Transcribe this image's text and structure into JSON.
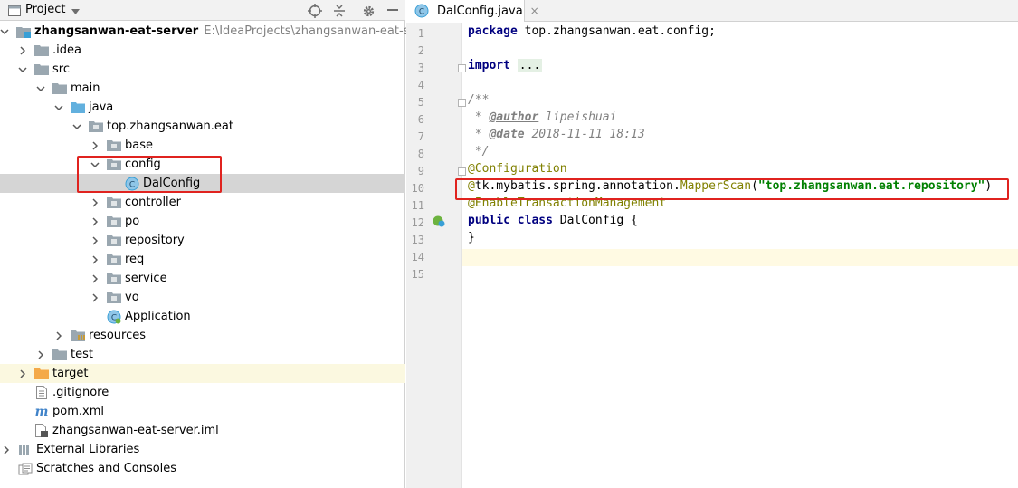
{
  "project_panel": {
    "title": "Project",
    "header_icons": [
      "locate-icon",
      "collapse-icon",
      "settings-icon",
      "hide-icon"
    ]
  },
  "tree": [
    {
      "id": "root",
      "label": "zhangsanwan-eat-server",
      "path": "E:\\IdeaProjects\\zhangsanwan-eat-server",
      "icon": "module-folder-icon",
      "expanded": true
    },
    {
      "id": "idea",
      "label": ".idea",
      "icon": "folder-icon",
      "expanded": false
    },
    {
      "id": "src",
      "label": "src",
      "icon": "folder-icon",
      "expanded": true
    },
    {
      "id": "main",
      "label": "main",
      "icon": "folder-icon",
      "expanded": true
    },
    {
      "id": "java",
      "label": "java",
      "icon": "source-folder-icon",
      "expanded": true
    },
    {
      "id": "pkg",
      "label": "top.zhangsanwan.eat",
      "icon": "package-icon",
      "expanded": true
    },
    {
      "id": "base",
      "label": "base",
      "icon": "package-icon",
      "expanded": false
    },
    {
      "id": "config",
      "label": "config",
      "icon": "package-icon",
      "expanded": true
    },
    {
      "id": "dalconfig",
      "label": "DalConfig",
      "icon": "class-icon",
      "selected": true
    },
    {
      "id": "controller",
      "label": "controller",
      "icon": "package-icon",
      "expanded": false
    },
    {
      "id": "po",
      "label": "po",
      "icon": "package-icon",
      "expanded": false
    },
    {
      "id": "repository",
      "label": "repository",
      "icon": "package-icon",
      "expanded": false
    },
    {
      "id": "req",
      "label": "req",
      "icon": "package-icon",
      "expanded": false
    },
    {
      "id": "service",
      "label": "service",
      "icon": "package-icon",
      "expanded": false
    },
    {
      "id": "vo",
      "label": "vo",
      "icon": "package-icon",
      "expanded": false
    },
    {
      "id": "application",
      "label": "Application",
      "icon": "spring-class-icon"
    },
    {
      "id": "resources",
      "label": "resources",
      "icon": "resources-folder-icon",
      "expanded": false
    },
    {
      "id": "test",
      "label": "test",
      "icon": "folder-icon",
      "expanded": false
    },
    {
      "id": "target",
      "label": "target",
      "icon": "excluded-folder-icon",
      "expanded": false
    },
    {
      "id": "gitignore",
      "label": ".gitignore",
      "icon": "text-file-icon"
    },
    {
      "id": "pom",
      "label": "pom.xml",
      "icon": "maven-icon"
    },
    {
      "id": "iml",
      "label": "zhangsanwan-eat-server.iml",
      "icon": "iml-file-icon"
    },
    {
      "id": "extlibs",
      "label": "External Libraries",
      "icon": "libraries-icon",
      "expanded": false
    },
    {
      "id": "scratches",
      "label": "Scratches and Consoles",
      "icon": "scratches-icon"
    }
  ],
  "editor": {
    "tab": {
      "label": "DalConfig.java",
      "close": "×"
    },
    "code": {
      "l1_kw": "package",
      "l1_rest": " top.zhangsanwan.eat.config;",
      "l3_kw": "import",
      "l3_dots": "...",
      "l6": "/**",
      "l7_star": " * ",
      "l7_tag": "@author",
      "l7_val": " lipeishuai",
      "l8_star": " * ",
      "l8_tag": "@date",
      "l8_val": " 2018-11-11 18:13",
      "l9": " */",
      "l10": "@Configuration",
      "l11_a": "@",
      "l11_b": "tk.mybatis.spring.annotation.",
      "l11_c": "MapperScan",
      "l11_d": "(",
      "l11_str": "\"top.zhangsanwan.eat.repository\"",
      "l11_e": ")",
      "l12": "@EnableTransactionManagement",
      "l13_kw": "public class",
      "l13_rest": " DalConfig {",
      "l14": "}"
    }
  },
  "colors": {
    "highlight_box": "#e0231f",
    "selection": "#d5d5d5",
    "keyword": "#000080",
    "annotation": "#808000",
    "string": "#008000"
  }
}
